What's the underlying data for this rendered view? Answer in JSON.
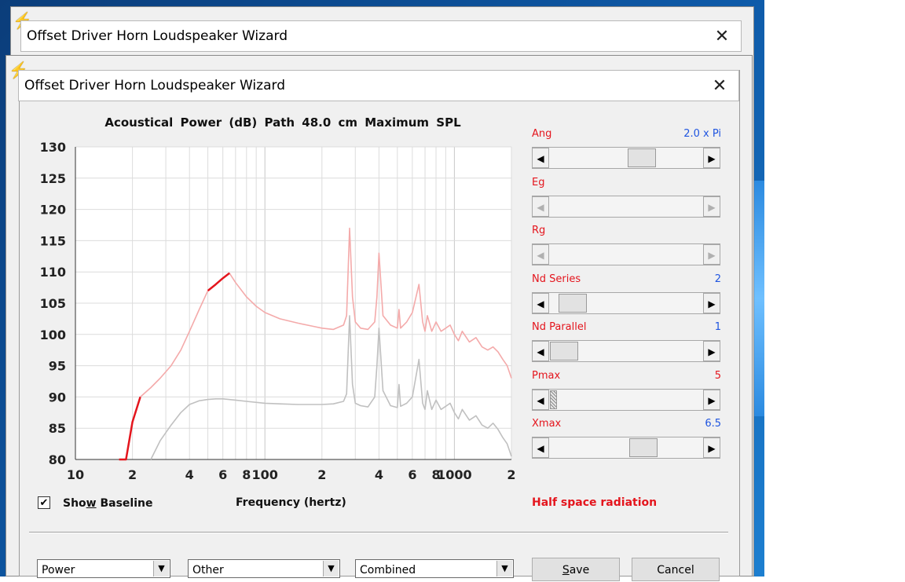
{
  "window": {
    "title": "Offset Driver Horn Loudspeaker Wizard"
  },
  "chart_title": "Acoustical Power (dB)   Path 48.0 cm   Maximum SPL",
  "chart_data": {
    "type": "line",
    "title": "Acoustical Power (dB)   Path 48.0 cm   Maximum SPL",
    "xlabel": "Frequency (hertz)",
    "ylabel": "",
    "x_scale": "log",
    "xlim": [
      10,
      2000
    ],
    "ylim": [
      80,
      130
    ],
    "grid": true,
    "y_ticks": [
      130,
      125,
      120,
      115,
      110,
      105,
      100,
      95,
      90,
      85,
      80
    ],
    "x_tick_labels": [
      {
        "f": 10,
        "label": "10"
      },
      {
        "f": 20,
        "label": "2"
      },
      {
        "f": 40,
        "label": "4"
      },
      {
        "f": 60,
        "label": "6"
      },
      {
        "f": 80,
        "label": "8"
      },
      {
        "f": 100,
        "label": "100"
      },
      {
        "f": 200,
        "label": "2"
      },
      {
        "f": 400,
        "label": "4"
      },
      {
        "f": 600,
        "label": "6"
      },
      {
        "f": 800,
        "label": "8"
      },
      {
        "f": 1000,
        "label": "1000"
      },
      {
        "f": 2000,
        "label": "2"
      }
    ],
    "series": [
      {
        "color": "#f4aaaa",
        "x": [
          18.5,
          20,
          22,
          25,
          28,
          32,
          36,
          40,
          45,
          50,
          55,
          60,
          65,
          70,
          80,
          90,
          100,
          120,
          150,
          180,
          200,
          230,
          260,
          270,
          280,
          290,
          300,
          320,
          350,
          380,
          390,
          400,
          420,
          460,
          500,
          510,
          520,
          560,
          600,
          650,
          680,
          700,
          720,
          760,
          800,
          850,
          900,
          950,
          1000,
          1050,
          1100,
          1200,
          1300,
          1400,
          1500,
          1600,
          1700,
          1800,
          1900,
          2000
        ],
        "y": [
          80,
          86,
          90,
          91.5,
          93,
          95,
          97.5,
          100.5,
          104,
          107,
          108,
          109,
          109.8,
          108.3,
          106,
          104.5,
          103.5,
          102.5,
          101.8,
          101.3,
          101,
          100.8,
          101.5,
          103,
          117,
          106,
          102,
          101,
          100.8,
          102,
          106,
          113,
          103,
          101.5,
          101,
          104,
          101,
          102,
          103.5,
          108,
          102,
          100.5,
          103,
          100.5,
          102,
          100.5,
          101,
          101.5,
          100,
          99,
          100.5,
          98.8,
          99.5,
          98,
          97.5,
          98,
          97.2,
          96,
          95,
          93
        ]
      },
      {
        "color": "#c0c0c0",
        "x": [
          25,
          28,
          32,
          36,
          40,
          45,
          50,
          55,
          60,
          70,
          80,
          100,
          120,
          150,
          180,
          200,
          230,
          260,
          270,
          280,
          290,
          300,
          320,
          350,
          380,
          390,
          400,
          420,
          460,
          500,
          510,
          520,
          560,
          600,
          650,
          680,
          700,
          720,
          760,
          800,
          850,
          900,
          950,
          1000,
          1050,
          1100,
          1200,
          1300,
          1400,
          1500,
          1600,
          1700,
          1800,
          1900,
          2000
        ],
        "y": [
          80,
          83,
          85.5,
          87.5,
          88.8,
          89.4,
          89.6,
          89.7,
          89.7,
          89.5,
          89.3,
          89,
          88.9,
          88.8,
          88.8,
          88.8,
          88.9,
          89.3,
          90.5,
          103,
          92,
          89,
          88.6,
          88.4,
          90,
          95,
          101,
          91,
          88.6,
          88.3,
          92,
          88.5,
          89,
          90,
          96,
          89,
          88,
          91,
          88,
          89.5,
          88,
          88.5,
          89,
          87.5,
          86.5,
          88,
          86.3,
          87,
          85.5,
          85,
          85.8,
          84.8,
          83.5,
          82.5,
          80.5
        ]
      },
      {
        "color": "#e4151d",
        "x": [
          17,
          18.5,
          20,
          22
        ],
        "y": [
          78,
          80,
          86,
          90
        ]
      },
      {
        "color": "#e4151d",
        "x": [
          50,
          55,
          60,
          65
        ],
        "y": [
          107,
          108,
          109,
          109.8
        ]
      }
    ]
  },
  "controls": [
    {
      "label": "Ang",
      "value": "2.0 x Pi",
      "value_color": "blue",
      "disabled": false,
      "level": 0.62,
      "thumb": "normal"
    },
    {
      "label": "Eg",
      "value": "",
      "value_color": "blue",
      "disabled": true,
      "level": null,
      "thumb": "none"
    },
    {
      "label": "Rg",
      "value": "",
      "value_color": "blue",
      "disabled": true,
      "level": null,
      "thumb": "none"
    },
    {
      "label": "Nd  Series",
      "value": "2",
      "value_color": "blue",
      "disabled": false,
      "level": 0.07,
      "thumb": "normal"
    },
    {
      "label": "Nd  Parallel",
      "value": "1",
      "value_color": "blue",
      "disabled": false,
      "level": 0.0,
      "thumb": "normal"
    },
    {
      "label": "Pmax",
      "value": "5",
      "value_color": "red",
      "disabled": false,
      "level": 0.0,
      "thumb": "hatched"
    },
    {
      "label": "Xmax",
      "value": "6.5",
      "value_color": "blue",
      "disabled": false,
      "level": 0.63,
      "thumb": "normal"
    }
  ],
  "baseline_checkbox": {
    "label_pre": "Sho",
    "label_u": "w",
    "label_post": " Baseline",
    "checked": true
  },
  "radiation_text": "Half space radiation",
  "combos": [
    {
      "value": "Power"
    },
    {
      "value": "Other"
    },
    {
      "value": "Combined"
    }
  ],
  "buttons": {
    "save": {
      "u": "S",
      "rest": "ave"
    },
    "cancel": "Cancel"
  }
}
